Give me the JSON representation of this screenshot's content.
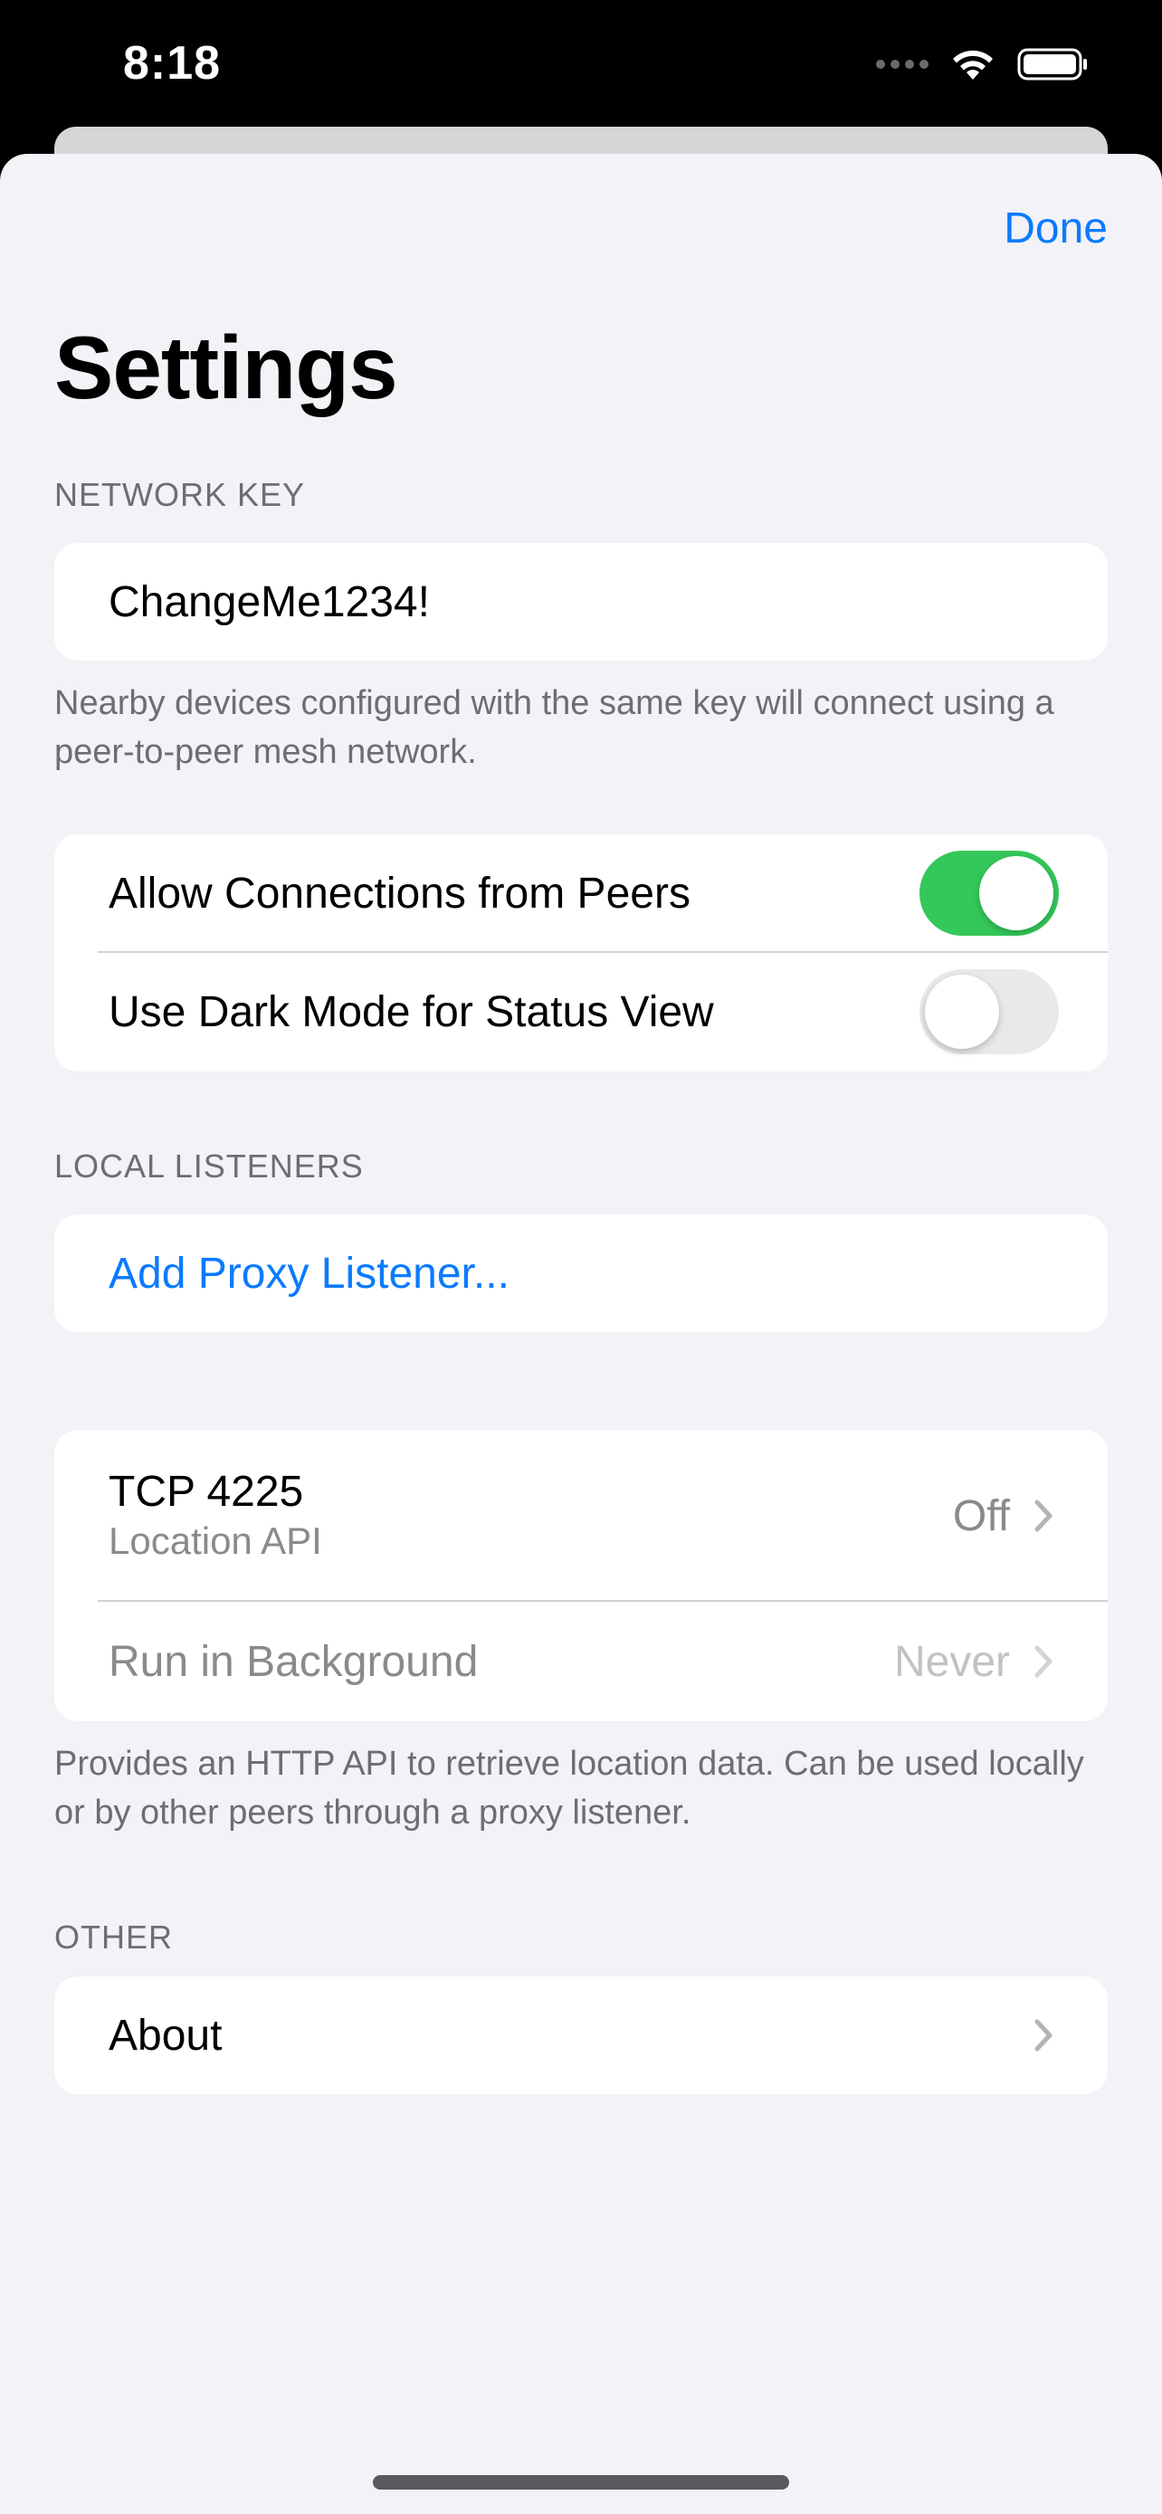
{
  "status_bar": {
    "time": "8:18",
    "signal_icon": "signal-dots-icon",
    "wifi_icon": "wifi-icon",
    "battery_icon": "battery-icon"
  },
  "nav": {
    "done_label": "Done"
  },
  "page": {
    "title": "Settings"
  },
  "network_key": {
    "header": "NETWORK KEY",
    "value": "ChangeMe1234!",
    "footer": "Nearby devices configured with the same key will connect using a peer-to-peer mesh network."
  },
  "toggles": [
    {
      "label": "Allow Connections from Peers",
      "on": true
    },
    {
      "label": "Use Dark Mode for Status View",
      "on": false
    }
  ],
  "local_listeners": {
    "header": "LOCAL LISTENERS",
    "add_label": "Add Proxy Listener..."
  },
  "service": {
    "title": "TCP 4225",
    "subtitle": "Location API",
    "status": "Off",
    "background_label": "Run in Background",
    "background_value": "Never",
    "footer": "Provides an HTTP API to retrieve location data. Can be used locally or by other peers through a proxy listener."
  },
  "other": {
    "header": "OTHER",
    "about_label": "About"
  },
  "colors": {
    "accent": "#0a7aff",
    "toggle_on": "#34c759",
    "background": "#f2f2f7"
  }
}
